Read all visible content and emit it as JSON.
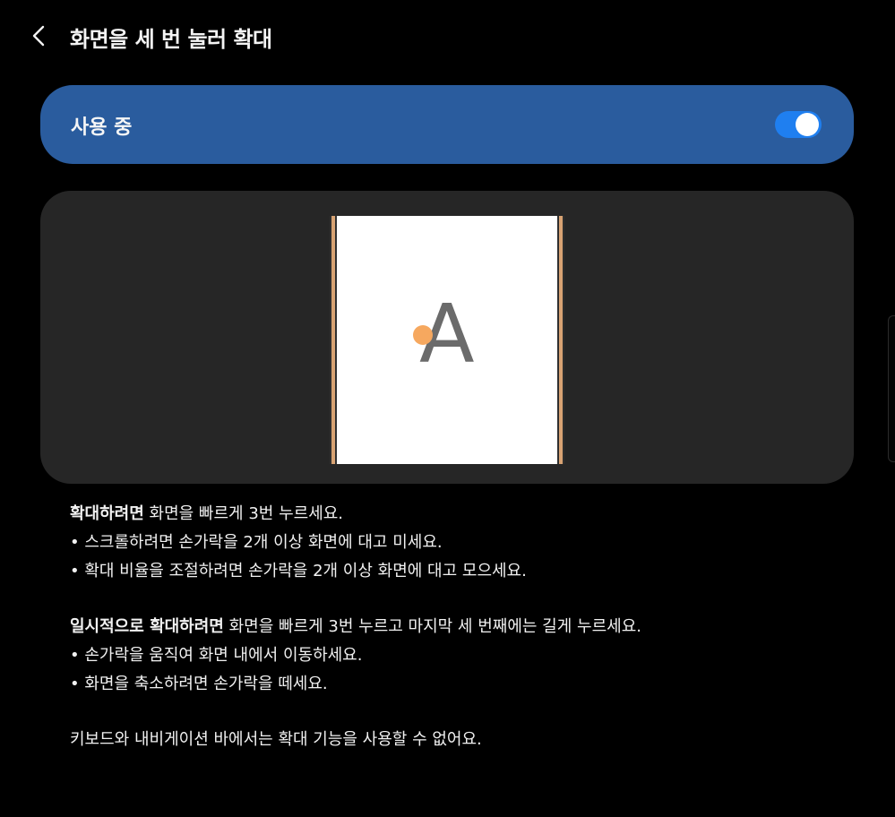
{
  "header": {
    "back_icon": "back-chevron-icon",
    "title": "화면을 세 번 눌러 확대"
  },
  "switch_bar": {
    "label": "사용 중",
    "enabled": true,
    "accent_color": "#1f7ff0",
    "bar_color": "#2a5c9e"
  },
  "preview": {
    "letter": "A",
    "tap_indicator_color": "#f6a85f"
  },
  "instructions": {
    "section1": {
      "lead_bold": "확대하려면",
      "lead_rest": " 화면을 빠르게 3번 누르세요.",
      "bullet1": "• 스크롤하려면 손가락을 2개 이상 화면에 대고 미세요.",
      "bullet2": "• 확대 비율을 조절하려면 손가락을 2개 이상 화면에 대고 모으세요."
    },
    "section2": {
      "lead_bold": "일시적으로 확대하려면",
      "lead_rest": " 화면을 빠르게 3번 누르고 마지막 세 번째에는 길게 누르세요.",
      "bullet1": "• 손가락을 움직여 화면 내에서 이동하세요.",
      "bullet2": "• 화면을 축소하려면 손가락을 떼세요."
    },
    "note": "키보드와 내비게이션 바에서는 확대 기능을 사용할 수 없어요."
  }
}
